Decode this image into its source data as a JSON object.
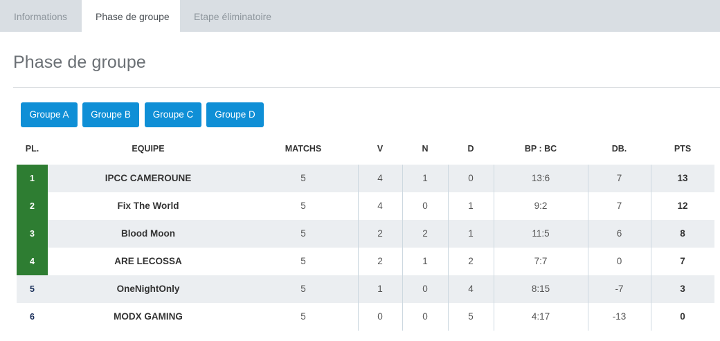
{
  "tabs": [
    {
      "label": "Informations"
    },
    {
      "label": "Phase de groupe"
    },
    {
      "label": "Etape éliminatoire"
    }
  ],
  "page_title": "Phase de groupe",
  "group_buttons": [
    "Groupe A",
    "Groupe B",
    "Groupe C",
    "Groupe D"
  ],
  "table": {
    "headers": {
      "pl": "PL.",
      "equipe": "EQUIPE",
      "matchs": "MATCHS",
      "v": "V",
      "n": "N",
      "d": "D",
      "bpbc": "BP : BC",
      "db": "DB.",
      "pts": "PTS"
    },
    "rows": [
      {
        "pl": "1",
        "team": "IPCC CAMEROUNE",
        "matchs": "5",
        "v": "4",
        "n": "1",
        "d": "0",
        "bpbc": "13:6",
        "db": "7",
        "pts": "13"
      },
      {
        "pl": "2",
        "team": "Fix The World",
        "matchs": "5",
        "v": "4",
        "n": "0",
        "d": "1",
        "bpbc": "9:2",
        "db": "7",
        "pts": "12"
      },
      {
        "pl": "3",
        "team": "Blood Moon",
        "matchs": "5",
        "v": "2",
        "n": "2",
        "d": "1",
        "bpbc": "11:5",
        "db": "6",
        "pts": "8"
      },
      {
        "pl": "4",
        "team": "ARE LECOSSA",
        "matchs": "5",
        "v": "2",
        "n": "1",
        "d": "2",
        "bpbc": "7:7",
        "db": "0",
        "pts": "7"
      },
      {
        "pl": "5",
        "team": "OneNightOnly",
        "matchs": "5",
        "v": "1",
        "n": "0",
        "d": "4",
        "bpbc": "8:15",
        "db": "-7",
        "pts": "3"
      },
      {
        "pl": "6",
        "team": "MODX GAMING",
        "matchs": "5",
        "v": "0",
        "n": "0",
        "d": "5",
        "bpbc": "4:17",
        "db": "-13",
        "pts": "0"
      }
    ]
  },
  "colors": {
    "accent": "#0f8fd6",
    "qualified": "#2e7d32",
    "tabbar": "#d9dee3",
    "row_stripe": "#ebeef1"
  }
}
